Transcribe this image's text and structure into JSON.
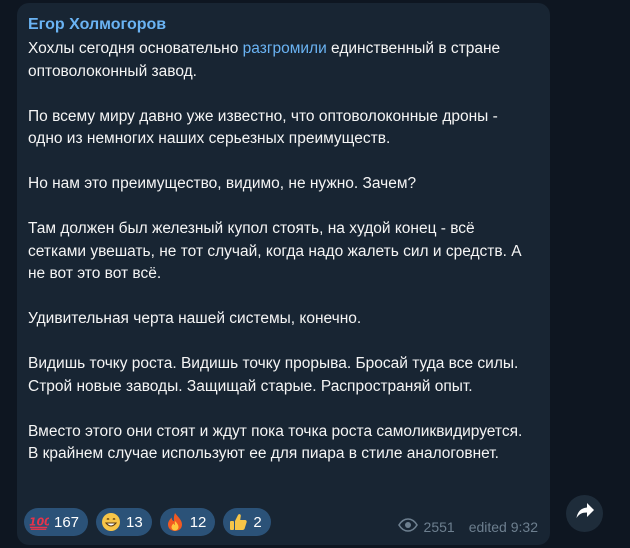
{
  "message": {
    "author": "Егор Холмогоров",
    "paragraphs": [
      {
        "before": "Хохлы сегодня основательно ",
        "link": "разгромили",
        "after": " единственный в стране оптоволоконный завод."
      },
      "По всему миру давно уже известно, что оптоволоконные дроны - одно из немногих наших серьезных преимуществ.",
      "Но нам это преимущество, видимо, не нужно. Зачем?",
      "Там должен был железный купол стоять, на худой конец - всё сетками увешать, не тот случай, когда надо жалеть сил и средств. А не вот это вот всё.",
      "Удивительная черта нашей системы, конечно.",
      "Видишь точку роста. Видишь точку прорыва. Бросай туда все силы. Строй новые заводы. Защищай старые. Распространяй опыт.",
      "Вместо этого они стоят и ждут пока точка роста самоликвидируется. В крайнем случае используют ее для пиара в стиле аналоговнет."
    ],
    "reactions": [
      {
        "icon": "hundred-points-icon",
        "count": "167"
      },
      {
        "icon": "grinning-face-icon",
        "count": "13"
      },
      {
        "icon": "fire-icon",
        "count": "12"
      },
      {
        "icon": "thumbs-up-icon",
        "count": "2"
      }
    ],
    "views": "2551",
    "edited_label": "edited 9:32"
  },
  "colors": {
    "background": "#0e1621",
    "bubble": "#182533",
    "accent": "#6ab3f3",
    "reaction_pill": "#2b5278",
    "meta_text": "#6d7f8f"
  },
  "share_icon": "share-arrow-icon"
}
